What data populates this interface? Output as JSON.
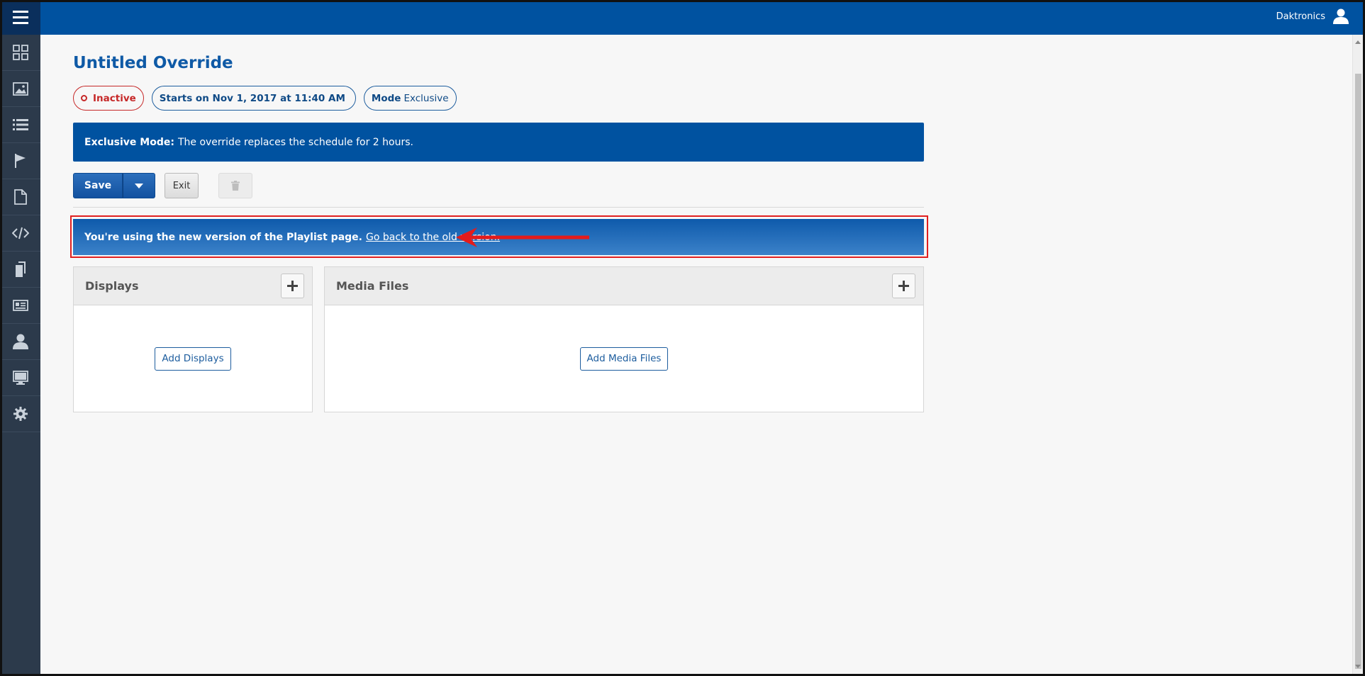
{
  "header": {
    "user_name": "Daktronics",
    "menu_icon": "hamburger-menu-icon",
    "user_icon": "user-avatar-icon"
  },
  "sidebar": {
    "items": [
      {
        "icon": "dashboard-grid-icon"
      },
      {
        "icon": "image-icon"
      },
      {
        "icon": "list-icon"
      },
      {
        "icon": "flag-icon"
      },
      {
        "icon": "document-icon"
      },
      {
        "icon": "code-icon"
      },
      {
        "icon": "clipboard-copy-icon"
      },
      {
        "icon": "id-card-icon"
      },
      {
        "icon": "user-icon"
      },
      {
        "icon": "monitor-icon"
      },
      {
        "icon": "gear-icon"
      }
    ]
  },
  "page": {
    "title": "Untitled Override",
    "status_badge": "Inactive",
    "starts_badge": "Starts on Nov 1, 2017 at 11:40 AM",
    "mode_label": "Mode",
    "mode_value": "Exclusive"
  },
  "info": {
    "label": "Exclusive Mode:",
    "text": "The override replaces the schedule for 2 hours."
  },
  "toolbar": {
    "save_label": "Save",
    "exit_label": "Exit"
  },
  "banner": {
    "text": "You're using the new version of the Playlist page.",
    "link": "Go back to the old version."
  },
  "panels": {
    "displays": {
      "title": "Displays",
      "add_label": "Add Displays"
    },
    "media": {
      "title": "Media Files",
      "add_label": "Add Media Files"
    }
  },
  "colors": {
    "brand_blue": "#0052a0",
    "sidebar_dark": "#2c3a4b",
    "inactive_red": "#c62828",
    "annotation_red": "#e02020"
  }
}
